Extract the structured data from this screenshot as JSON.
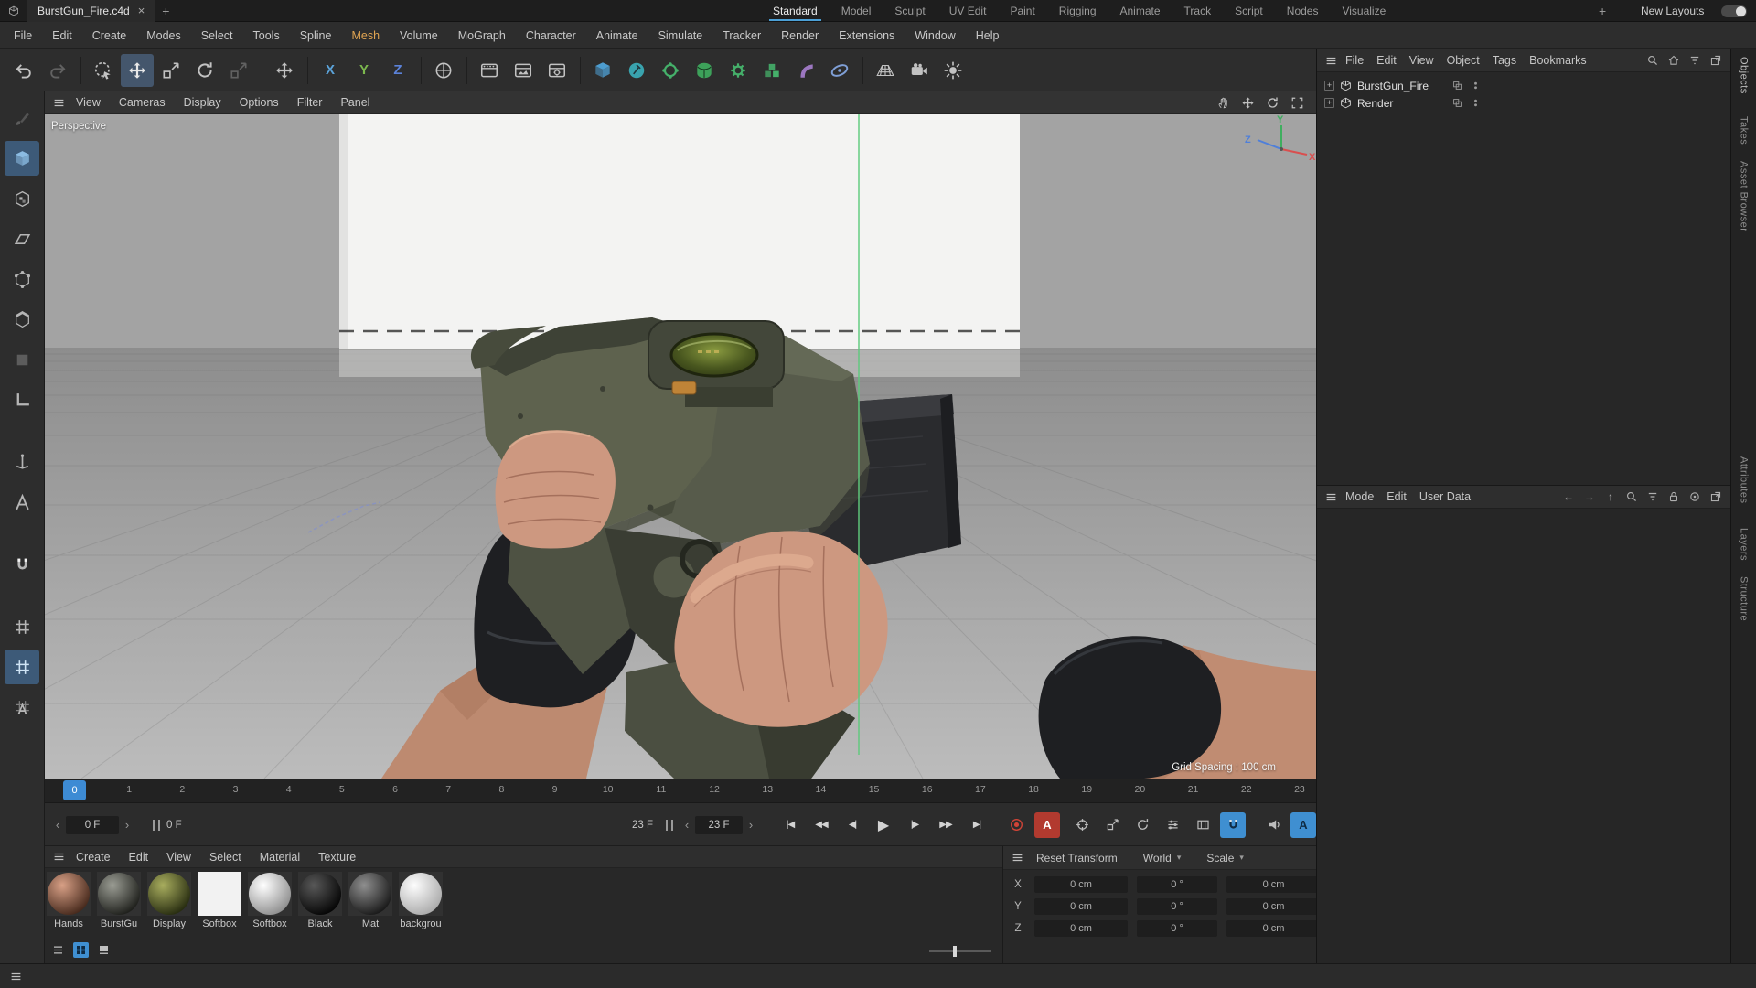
{
  "colors": {
    "accent_blue": "#4b9fd5",
    "record_red": "#b23a2f",
    "menu_highlight_amber": "#e0a452",
    "axis_x_red": "#d94f4f",
    "axis_y_green": "#3fae5f",
    "axis_z_blue": "#4f7fd9",
    "guide_green": "#5fca7d"
  },
  "titlebar": {
    "document_tab": "BurstGun_Fire.c4d",
    "close_glyph": "×",
    "add_tab_glyph": "+",
    "layouts": [
      "Standard",
      "Model",
      "Sculpt",
      "UV Edit",
      "Paint",
      "Rigging",
      "Animate",
      "Track",
      "Script",
      "Nodes",
      "Visualize"
    ],
    "active_layout": "Standard",
    "add_layout_glyph": "+",
    "new_layouts_label": "New Layouts"
  },
  "menubar": {
    "items": [
      "File",
      "Edit",
      "Create",
      "Modes",
      "Select",
      "Tools",
      "Spline",
      "Mesh",
      "Volume",
      "MoGraph",
      "Character",
      "Animate",
      "Simulate",
      "Tracker",
      "Render",
      "Extensions",
      "Window",
      "Help"
    ],
    "highlighted_item": "Mesh"
  },
  "toolbar": {
    "groups": [
      [
        {
          "name": "undo-icon",
          "type": "undo"
        },
        {
          "name": "redo-icon",
          "type": "redo",
          "dim": true
        }
      ],
      [
        {
          "name": "live-selection-tool",
          "type": "livesel"
        },
        {
          "name": "move-tool",
          "type": "move",
          "active": true,
          "color": "#e8e8e8"
        },
        {
          "name": "scale-tool",
          "type": "scale"
        },
        {
          "name": "rotate-tool",
          "type": "rotate"
        },
        {
          "name": "last-tool",
          "type": "scale",
          "dim": true
        }
      ],
      [
        {
          "name": "axis-modify-tool",
          "type": "move"
        }
      ],
      [
        {
          "name": "lock-x-axis",
          "letter": "X",
          "color": "#5ba2d8"
        },
        {
          "name": "lock-y-axis",
          "letter": "Y",
          "color": "#7cb84e"
        },
        {
          "name": "lock-z-axis",
          "letter": "Z",
          "color": "#5b82d8"
        }
      ],
      [
        {
          "name": "coordinate-system-toggle",
          "type": "coords"
        }
      ],
      [
        {
          "name": "render-view-button",
          "type": "render"
        },
        {
          "name": "render-picture-viewer-button",
          "type": "render2"
        },
        {
          "name": "render-settings-button",
          "type": "render3"
        }
      ],
      [
        {
          "name": "add-primitive-cube",
          "type": "cube",
          "color": "#4fa3d8"
        },
        {
          "name": "add-spline-pen",
          "type": "pen",
          "color": "#3cb8c6"
        },
        {
          "name": "add-generator",
          "type": "gen",
          "color": "#45b06a"
        },
        {
          "name": "add-subdivision-surface",
          "type": "sds",
          "color": "#3fae5f"
        },
        {
          "name": "add-mograph",
          "type": "gear",
          "color": "#45b06a"
        },
        {
          "name": "add-volume",
          "type": "vol",
          "color": "#45b06a"
        },
        {
          "name": "add-deformer",
          "type": "deform",
          "color": "#a87fd0"
        },
        {
          "name": "add-field",
          "type": "field",
          "color": "#7f9fd6"
        }
      ],
      [
        {
          "name": "add-floor",
          "type": "floor"
        },
        {
          "name": "add-camera",
          "type": "camera"
        },
        {
          "name": "add-light",
          "type": "light"
        }
      ]
    ]
  },
  "palette": {
    "groups": [
      [
        {
          "name": "brush-tool-icon",
          "type": "brush",
          "dim": true
        },
        {
          "name": "model-mode-icon",
          "type": "cube",
          "active": true,
          "color": "#8fc1e8"
        },
        {
          "name": "texture-mode-icon",
          "type": "cubetex"
        },
        {
          "name": "uv-mode-icon",
          "type": "plane"
        },
        {
          "name": "points-mode-icon",
          "type": "hexp"
        },
        {
          "name": "edges-mode-icon",
          "type": "hexe"
        },
        {
          "name": "polygons-mode-icon",
          "type": "polyf",
          "dim": true
        },
        {
          "name": "workplane-mode-icon",
          "type": "lshape"
        }
      ],
      [
        {
          "name": "axis-mode-icon",
          "type": "axisc"
        },
        {
          "name": "solo-mode-icon",
          "type": "soloA"
        }
      ],
      [
        {
          "name": "snap-magnet-icon",
          "type": "magnet"
        }
      ],
      [
        {
          "name": "workplane-grid-icon",
          "type": "grid"
        },
        {
          "name": "grid-snap-icon",
          "type": "grid",
          "active": true,
          "color": "#cfe4f5"
        },
        {
          "name": "quantize-grid-icon",
          "type": "gridA"
        }
      ]
    ]
  },
  "viewport": {
    "menu_items": [
      "View",
      "Cameras",
      "Display",
      "Options",
      "Filter",
      "Panel"
    ],
    "camera_label": "Perspective",
    "grid_spacing_label": "Grid Spacing : 100 cm",
    "axis_labels": {
      "x": "X",
      "y": "Y",
      "z": "Z"
    },
    "nav_icons": [
      {
        "name": "pan-icon",
        "type": "pan"
      },
      {
        "name": "dolly-icon",
        "type": "dolly"
      },
      {
        "name": "orbit-icon",
        "type": "orbit"
      },
      {
        "name": "maximize-icon",
        "type": "maxi"
      }
    ]
  },
  "object_manager": {
    "menu_items": [
      "File",
      "Edit",
      "View",
      "Object",
      "Tags",
      "Bookmarks"
    ],
    "header_icons": [
      {
        "name": "search-icon",
        "type": "search"
      },
      {
        "name": "home-icon",
        "type": "home"
      },
      {
        "name": "filter-icon",
        "type": "filt"
      },
      {
        "name": "popout-icon",
        "type": "popout"
      }
    ],
    "objects": [
      {
        "name": "BurstGun_Fire"
      },
      {
        "name": "Render"
      }
    ]
  },
  "attribute_manager": {
    "menu_items": [
      "Mode",
      "Edit",
      "User Data"
    ],
    "header_icons": [
      {
        "name": "back-icon",
        "glyph": "←"
      },
      {
        "name": "forward-icon",
        "glyph": "→",
        "dim": true
      },
      {
        "name": "up-icon",
        "glyph": "↑"
      },
      {
        "name": "search-icon",
        "type": "search"
      },
      {
        "name": "filter-icon",
        "type": "filt"
      },
      {
        "name": "lock-icon",
        "type": "lockic"
      },
      {
        "name": "target-icon",
        "type": "targ"
      },
      {
        "name": "popout-icon",
        "type": "popout"
      }
    ]
  },
  "right_tabs": [
    "Objects",
    "Takes",
    "Asset Browser",
    "Attributes",
    "Layers",
    "Structure"
  ],
  "timeline": {
    "ticks": [
      "0",
      "1",
      "2",
      "3",
      "4",
      "5",
      "6",
      "7",
      "8",
      "9",
      "10",
      "11",
      "12",
      "13",
      "14",
      "15",
      "16",
      "17",
      "18",
      "19",
      "20",
      "21",
      "22",
      "23"
    ],
    "playhead_value": "0"
  },
  "transport": {
    "current_frame": "0 F",
    "preview_start": "0 F",
    "range_end_label": "23 F",
    "end_frame": "23 F",
    "stepper_prev_glyph": "‹",
    "stepper_next_glyph": "›",
    "buttons": [
      {
        "name": "goto-start-button",
        "glyph": "|◀"
      },
      {
        "name": "prev-key-button",
        "glyph": "◀◀"
      },
      {
        "name": "prev-frame-button",
        "glyph": "◀|"
      },
      {
        "name": "play-button",
        "glyph": "▶",
        "big": true
      },
      {
        "name": "next-frame-button",
        "glyph": "|▶"
      },
      {
        "name": "next-key-button",
        "glyph": "▶▶"
      },
      {
        "name": "goto-end-button",
        "glyph": "▶|"
      }
    ],
    "record_buttons": [
      {
        "name": "record-keyframe-button",
        "type": "recdot",
        "cls": "redring"
      },
      {
        "name": "autokey-button",
        "letter": "A",
        "cls": "red"
      }
    ],
    "key_toggles": [
      {
        "name": "record-position-toggle",
        "type": "kpos"
      },
      {
        "name": "record-scale-toggle",
        "type": "kscl"
      },
      {
        "name": "record-rotation-toggle",
        "type": "krot"
      },
      {
        "name": "record-parameter-toggle",
        "type": "kparam"
      },
      {
        "name": "record-pla-toggle",
        "type": "kpla"
      },
      {
        "name": "keyframe-selection-toggle",
        "type": "magnet",
        "active": true
      }
    ],
    "extra_toggles": [
      {
        "name": "sound-toggle",
        "type": "speaker"
      }
    ],
    "autokey_selection_label": "A"
  },
  "materials_panel": {
    "menu_items": [
      "Create",
      "Edit",
      "View",
      "Select",
      "Material",
      "Texture"
    ],
    "materials": [
      {
        "label": "Hands",
        "shape": "sphere",
        "inner": "#d8a086",
        "outer": "#46291c"
      },
      {
        "label": "BurstGu",
        "shape": "sphere",
        "inner": "#9a9c93",
        "outer": "#1e1f1b"
      },
      {
        "label": "Display",
        "shape": "sphere",
        "inner": "#a8ad5e",
        "outer": "#272c10"
      },
      {
        "label": "Softbox",
        "shape": "plane",
        "inner": "#f2f2f2",
        "outer": "#f2f2f2"
      },
      {
        "label": "Softbox",
        "shape": "sphere",
        "inner": "#ffffff",
        "outer": "#8f8f8f"
      },
      {
        "label": "Black",
        "shape": "sphere",
        "inner": "#585858",
        "outer": "#050505"
      },
      {
        "label": "Mat",
        "shape": "sphere",
        "inner": "#8f8f8f",
        "outer": "#191919"
      },
      {
        "label": "backgrou",
        "shape": "sphere",
        "inner": "#fdfdfd",
        "outer": "#ababab"
      }
    ],
    "view_icons": [
      {
        "name": "list-view-icon",
        "type": "listv"
      },
      {
        "name": "grid-view-icon",
        "type": "gridv",
        "active": true
      },
      {
        "name": "icon-view-icon",
        "type": "iconv"
      }
    ]
  },
  "coordinates_panel": {
    "reset_button": "Reset Transform",
    "space_dropdown": "World",
    "mode_dropdown": "Scale",
    "rows": [
      {
        "axis": "X",
        "position": "0 cm",
        "rotation": "0 °",
        "scale": "0 cm"
      },
      {
        "axis": "Y",
        "position": "0 cm",
        "rotation": "0 °",
        "scale": "0 cm"
      },
      {
        "axis": "Z",
        "position": "0 cm",
        "rotation": "0 °",
        "scale": "0 cm"
      }
    ]
  }
}
